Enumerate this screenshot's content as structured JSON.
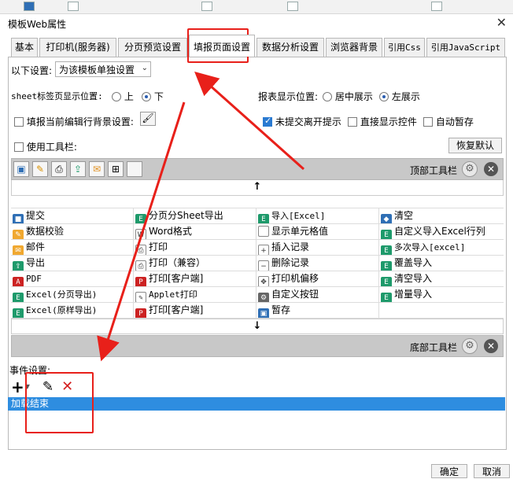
{
  "window": {
    "title": "模板Web属性",
    "close": "✕"
  },
  "tabs": [
    {
      "label": "基本"
    },
    {
      "label": "打印机(服务器)"
    },
    {
      "label": "分页预览设置"
    },
    {
      "label": "填报页面设置"
    },
    {
      "label": "数据分析设置"
    },
    {
      "label": "浏览器背景"
    },
    {
      "label": "引用Css"
    },
    {
      "label": "引用JavaScript"
    }
  ],
  "settings": {
    "label": "以下设置:",
    "select_value": "为该模板单独设置",
    "sheet_pos_label": "sheet标签页显示位置:",
    "sheet_top": "上",
    "sheet_bottom": "下",
    "report_pos_label": "报表显示位置:",
    "report_center": "居中展示",
    "report_left": "左展示",
    "fill_bg": "填报当前编辑行背景设置:",
    "unsubmitted": "未提交离开提示",
    "show_controls": "直接显示控件",
    "auto_save": "自动暂存",
    "use_toolbar": "使用工具栏:",
    "restore_default": "恢复默认"
  },
  "top_toolbar": {
    "label": "顶部工具栏"
  },
  "bottom_toolbar": {
    "label": "底部工具栏"
  },
  "arrow_up": "↑",
  "arrow_down": "↓",
  "grid": [
    [
      "提交",
      "分页分Sheet导出",
      "导入[Excel]",
      "清空"
    ],
    [
      "数据校验",
      "Word格式",
      "显示单元格值",
      "自定义导入Excel行列"
    ],
    [
      "邮件",
      "打印",
      "插入记录",
      "多次导入[excel]"
    ],
    [
      "导出",
      "打印（兼容）",
      "删除记录",
      "覆盖导入"
    ],
    [
      "PDF",
      "打印[客户端]",
      "打印机偏移",
      "清空导入"
    ],
    [
      "Excel(分页导出)",
      "Applet打印",
      "自定义按钮",
      "增量导入"
    ],
    [
      "Excel(原样导出)",
      "打印[客户端]",
      "暂存",
      ""
    ]
  ],
  "events": {
    "label": "事件设置:",
    "add": "+",
    "edit": "✎",
    "delete": "✕",
    "item": "加载结束"
  },
  "footer": {
    "ok": "确定",
    "cancel": "取消"
  },
  "colors": {
    "accent": "#2e8de0",
    "annotation": "#e8201a"
  }
}
